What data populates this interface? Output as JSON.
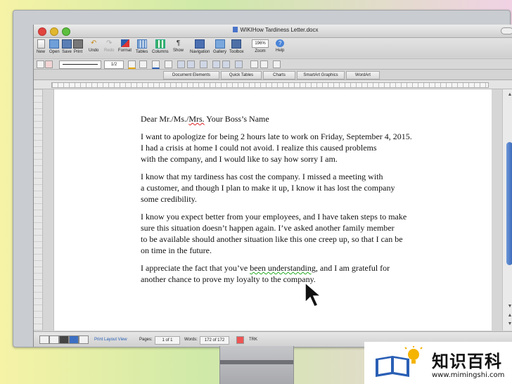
{
  "window": {
    "title": "WIKIHow Tardiness Letter.docx"
  },
  "toolbar": [
    {
      "label": "New",
      "icon": "new-document-icon"
    },
    {
      "label": "Open",
      "icon": "open-folder-icon"
    },
    {
      "label": "Save",
      "icon": "save-disk-icon"
    },
    {
      "label": "Print",
      "icon": "printer-icon"
    },
    {
      "label": "Undo",
      "icon": "undo-arrow-icon"
    },
    {
      "label": "Redo",
      "icon": "redo-arrow-icon"
    },
    {
      "label": "Format",
      "icon": "format-brush-icon"
    },
    {
      "label": "Tables",
      "icon": "table-grid-icon"
    },
    {
      "label": "Columns",
      "icon": "columns-icon"
    },
    {
      "label": "Show",
      "icon": "pilcrow-icon"
    },
    {
      "label": "Navigation",
      "icon": "navigation-pane-icon"
    },
    {
      "label": "Gallery",
      "icon": "gallery-icon"
    },
    {
      "label": "Toolbox",
      "icon": "toolbox-icon"
    },
    {
      "label": "Zoom",
      "value": "196%"
    },
    {
      "label": "Help",
      "icon": "help-icon"
    }
  ],
  "format_bar": {
    "line_weight": "1/2"
  },
  "ribbon_tabs": [
    "Document Elements",
    "Quick Tables",
    "Charts",
    "SmartArt Graphics",
    "WordArt"
  ],
  "letter": {
    "salutation": {
      "before": "Dear Mr./Ms./",
      "flagged": "Mrs.",
      "after": " Your Boss’s Name"
    },
    "p1": [
      "I want to apologize for being 2 hours late to work on Friday, September 4, 2015.",
      "I had a crisis at home I could not avoid. I realize this caused problems",
      "with the company, and I would like to say how sorry I am."
    ],
    "p2": [
      "I know that my tardiness has cost the company. I missed a meeting with",
      "a customer, and though I plan to make it up, I know it has lost the company",
      "some credibility."
    ],
    "p3": [
      "I know you expect better from your employees, and I have taken steps to make",
      "sure this situation doesn’t happen again. I’ve asked another family member",
      "to be available should another situation like this one creep up, so that I can be",
      "on time in the future."
    ],
    "p4": {
      "l1_before": "I appreciate the fact that you’ve ",
      "l1_flagged": "been understanding",
      "l1_after": ", and I am grateful for",
      "l2": "another chance to prove my loyalty to the company."
    }
  },
  "status": {
    "view": "Print Layout View",
    "pages_label": "Pages:",
    "pages_value": "1 of 1",
    "words_label": "Words:",
    "words_value": "172 of 172",
    "trk": "TRK"
  },
  "watermark": {
    "text": "知识百科",
    "url": "www.mimingshi.com"
  }
}
